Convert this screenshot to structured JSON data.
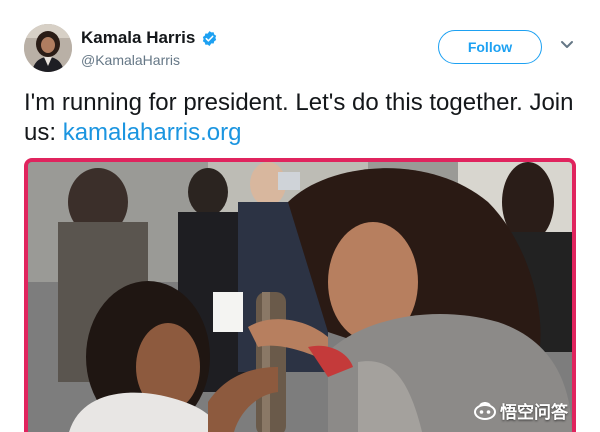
{
  "tweet": {
    "author": {
      "name": "Kamala Harris",
      "handle": "@KamalaHarris",
      "avatar_icon": "profile-photo",
      "verified_icon": "verified-badge-icon"
    },
    "follow_label": "Follow",
    "menu_icon": "chevron-down-icon",
    "text": "I'm running for president. Let's do this together. Join us: ",
    "link": "kamalaharris.org",
    "media": {
      "description_icon": "photo-kamala-harris-with-child"
    }
  },
  "watermark": {
    "text": "悟空问答"
  },
  "colors": {
    "accent": "#1da1f2",
    "link": "#1b95e0",
    "media_border": "#e0245e",
    "text": "#14171a",
    "muted": "#657786"
  }
}
